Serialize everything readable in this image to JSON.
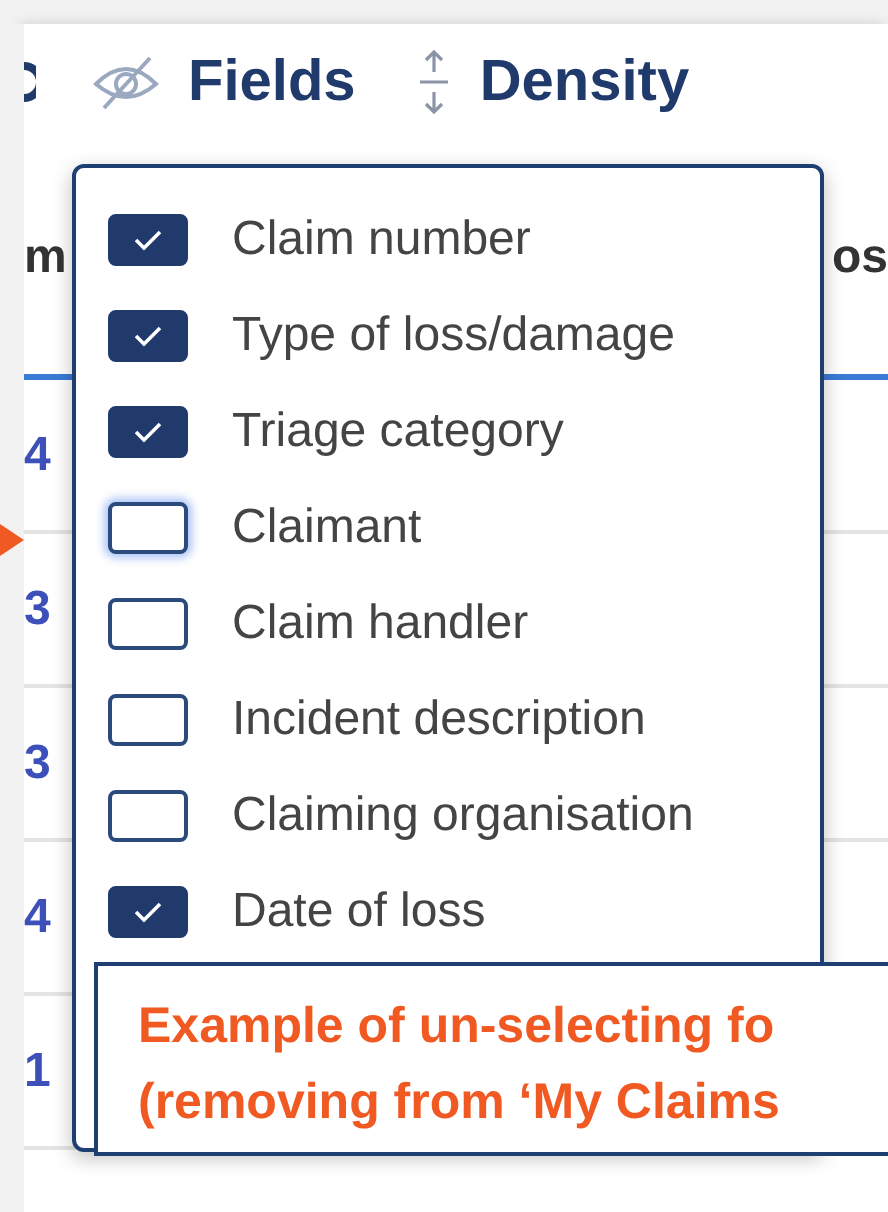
{
  "toolbar": {
    "buttons": [
      {
        "kind": "fields",
        "label": "Fields"
      },
      {
        "kind": "density",
        "label": "Density"
      }
    ]
  },
  "table": {
    "header": {
      "column_1": "m",
      "column_2": "os"
    },
    "rows": [
      {
        "column_1": "4"
      },
      {
        "column_1": "3"
      },
      {
        "column_1": "3"
      },
      {
        "column_1": "4"
      },
      {
        "column_1": "1"
      }
    ]
  },
  "fields_menu": {
    "items": [
      {
        "label": "Claim number",
        "checked": true,
        "focused": false
      },
      {
        "label": "Type of loss/damage",
        "checked": true,
        "focused": false
      },
      {
        "label": "Triage category",
        "checked": true,
        "focused": false
      },
      {
        "label": "Claimant",
        "checked": false,
        "focused": true
      },
      {
        "label": "Claim handler",
        "checked": false,
        "focused": false
      },
      {
        "label": "Incident description",
        "checked": false,
        "focused": false
      },
      {
        "label": "Claiming organisation",
        "checked": false,
        "focused": false
      },
      {
        "label": "Date of loss",
        "checked": true,
        "focused": false
      }
    ]
  },
  "callout": {
    "lines": [
      "Example of un-selecting fo",
      "(removing from ‘My Claims"
    ]
  }
}
